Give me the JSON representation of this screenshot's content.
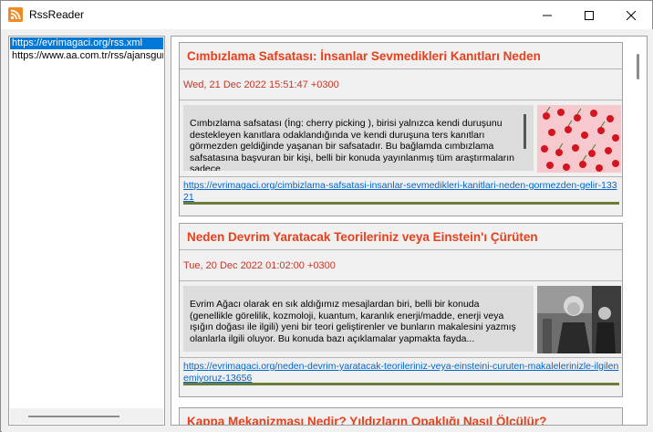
{
  "window": {
    "title": "RssReader",
    "controls": {
      "minimize_icon": "minimize-icon",
      "maximize_icon": "maximize-icon",
      "close_icon": "close-icon"
    }
  },
  "feeds": {
    "items": [
      {
        "label": "https://evrimagaci.org/rss.xml",
        "selected": true
      },
      {
        "label": "https://www.aa.com.tr/rss/ajansguncel.xml",
        "selected": false
      }
    ]
  },
  "articles": [
    {
      "title": "Cımbızlama Safsatası: İnsanlar Sevmedikleri Kanıtları Neden",
      "date": "Wed, 21 Dec 2022 15:51:47 +0300",
      "description": " Cımbızlama safsatası (İng:  cherry picking ), birisi yalnızca kendi duruşunu destekleyen kanıtlara odaklandığında ve kendi duruşuna ters kanıtları görmezden geldiğinde yaşanan bir safsatadır. Bu bağlamda cımbızlama safsatasına başvuran bir kişi, belli bir konuda yayınlanmış tüm araştırmaların sadece",
      "link": "https://evrimagaci.org/cimbizlama-safsatasi-insanlar-sevmedikleri-kanitlari-neden-gormezden-gelir-13321",
      "thumbnail": "cherries-image"
    },
    {
      "title": "Neden  Devrim Yaratacak  Teorileriniz veya  Einstein'ı Çürüten",
      "date": "Tue, 20 Dec 2022 01:02:00 +0300",
      "description": " Evrim Ağacı olarak en sık aldığımız mesajlardan biri, belli bir konuda (genellikle görelilik, kozmoloji, kuantum, karanlık enerji/madde, enerji veya ışığın doğası ile ilgili)  yeni bir teori  geliştirenler ve bunların  makalesini yazmış  olanlarla ilgili oluyor. Bu konuda bazı açıklamalar yapmakta fayda...",
      "link": "https://evrimagaci.org/neden-devrim-yaratacak-teorileriniz-veya-einsteini-curuten-makalelerinizle-ilgilenemiyoruz-13656",
      "thumbnail": "einstein-photo"
    },
    {
      "title": "Kappa Mekanizması Nedir? Yıldızların Opaklığı Nasıl Ölçülür?"
    }
  ],
  "colors": {
    "title": "#e8401c",
    "date": "#c0392b",
    "link": "#0066cc",
    "separator": "#6b7d3a",
    "selection": "#0078d7"
  }
}
